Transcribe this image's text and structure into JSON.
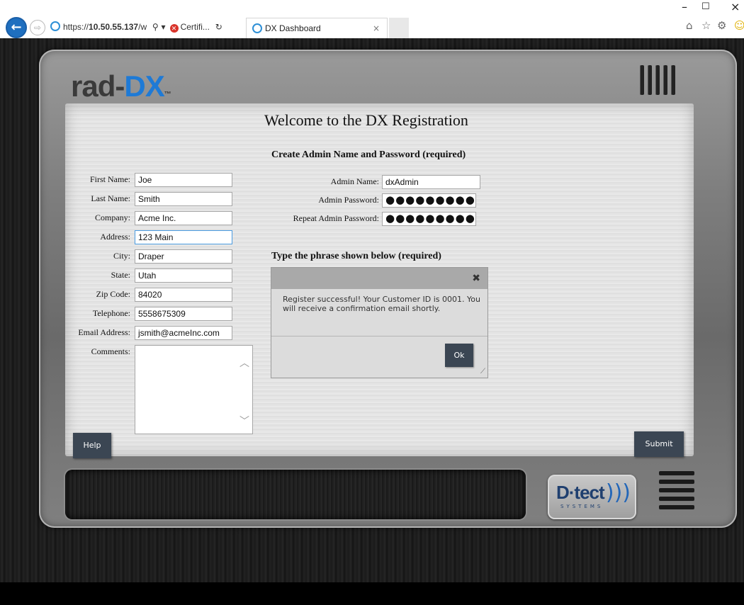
{
  "browser": {
    "url_prefix": "https://",
    "url_host": "10.50.55.137",
    "url_rest": "/w",
    "cert_label": "Certifi...",
    "tab_title": "DX Dashboard",
    "tab_close": "×",
    "search_icon": "search-icon",
    "refresh_icon": "refresh-icon"
  },
  "window": {
    "minimize": "–",
    "maximize": "☐",
    "close": "×"
  },
  "app": {
    "logo_part1": "rad-",
    "logo_part2": "DX",
    "logo_tm": "™"
  },
  "page": {
    "title": "Welcome to the DX Registration",
    "admin_section": "Create Admin Name and Password (required)",
    "phrase_section": "Type the phrase shown below (required)"
  },
  "form": {
    "first_name": {
      "label": "First Name:",
      "value": "Joe"
    },
    "last_name": {
      "label": "Last Name:",
      "value": "Smith"
    },
    "company": {
      "label": "Company:",
      "value": "Acme Inc."
    },
    "address": {
      "label": "Address:",
      "value": "123 Main"
    },
    "city": {
      "label": "City:",
      "value": "Draper"
    },
    "state": {
      "label": "State:",
      "value": "Utah"
    },
    "zip": {
      "label": "Zip Code:",
      "value": "84020"
    },
    "telephone": {
      "label": "Telephone:",
      "value": "5558675309"
    },
    "email": {
      "label": "Email Address:",
      "value": "jsmith@acmeInc.com"
    },
    "comments": {
      "label": "Comments:",
      "value": ""
    }
  },
  "admin": {
    "name": {
      "label": "Admin Name:",
      "value": "dxAdmin"
    },
    "password": {
      "label": "Admin Password:",
      "value": "●●●●●●●●●●"
    },
    "repeat": {
      "label": "Repeat Admin Password:",
      "value": "●●●●●●●●●●"
    }
  },
  "modal": {
    "message": "Register successful! Your Customer ID is 0001. You will receive a confirmation email shortly.",
    "close": "✖",
    "ok": "Ok"
  },
  "buttons": {
    "help": "Help",
    "submit": "Submit"
  },
  "brand": {
    "name": "D·tect",
    "sub": "SYSTEMS",
    "waves": ")))"
  },
  "colors": {
    "accent": "#1e7ad6",
    "button": "#3b4653",
    "frame": "#7e7e7e"
  }
}
